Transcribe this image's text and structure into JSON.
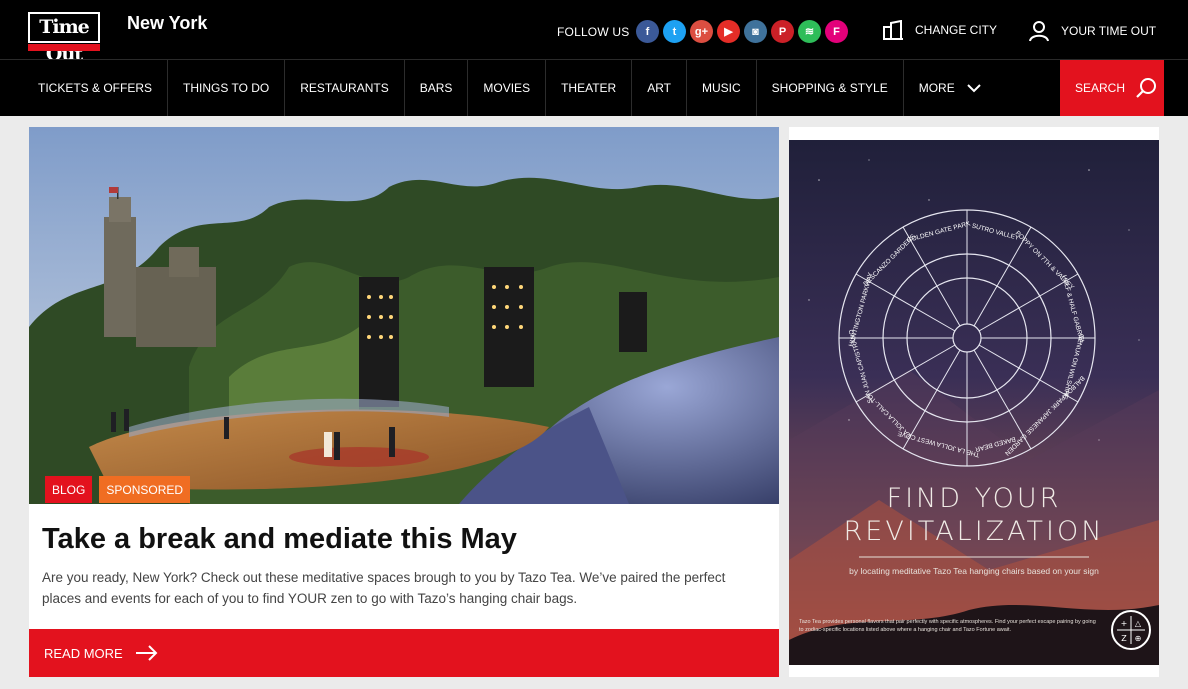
{
  "brand": {
    "logo_text": "Time Out",
    "city": "New York",
    "accent": "#e3121e"
  },
  "header": {
    "follow_label": "FOLLOW US",
    "socials": [
      {
        "icon": "facebook-icon",
        "glyph": "f",
        "color": "#3b5998"
      },
      {
        "icon": "twitter-icon",
        "glyph": "t",
        "color": "#1da1f2"
      },
      {
        "icon": "google-plus-icon",
        "glyph": "g+",
        "color": "#dc4e41"
      },
      {
        "icon": "youtube-icon",
        "glyph": "▶",
        "color": "#e52d27"
      },
      {
        "icon": "instagram-icon",
        "glyph": "◙",
        "color": "#3f729b"
      },
      {
        "icon": "pinterest-icon",
        "glyph": "P",
        "color": "#cb2027"
      },
      {
        "icon": "spotify-icon",
        "glyph": "≋",
        "color": "#2ebd59"
      },
      {
        "icon": "foursquare-icon",
        "glyph": "F",
        "color": "#e3007a"
      }
    ],
    "change_city": "CHANGE CITY",
    "your_timeout": "YOUR TIME OUT"
  },
  "nav": {
    "items": [
      {
        "label": "TICKETS & OFFERS"
      },
      {
        "label": "THINGS TO DO"
      },
      {
        "label": "RESTAURANTS"
      },
      {
        "label": "BARS"
      },
      {
        "label": "MOVIES"
      },
      {
        "label": "THEATER"
      },
      {
        "label": "ART"
      },
      {
        "label": "MUSIC"
      },
      {
        "label": "SHOPPING & STYLE"
      },
      {
        "label": "MORE"
      }
    ],
    "search_label": "SEARCH"
  },
  "feature": {
    "badges": [
      "BLOG",
      "SPONSORED"
    ],
    "headline": "Take a break and mediate this May",
    "summary": "Are you ready, New York? Check out these meditative spaces brough to you by Tazo Tea. We’ve paired the perfect places and events for each of you to find YOUR zen to go with Tazo’s hanging chair bags.",
    "read_more": "READ MORE"
  },
  "ad": {
    "headline_line1": "FIND YOUR",
    "headline_line2": "REVITALIZATION",
    "subline": "by locating meditative Tazo Tea hanging chairs based on your sign",
    "fine_print": "Tazo Tea provides personal flavors that pair perfectly with specific atmospheres. Find your perfect escape pairing by going to zodiac-specific locations listed above where a hanging chair and Tazo Fortune await.",
    "emblem_glyphs": "+ △ Z ⊕",
    "wheel_locations": [
      "SUTRO VALLEY",
      "POPPY ON 7TH & VALLEY",
      "HALF & HALF GABRIEL",
      "GENUA ON WILSHIRE",
      "BALBOA PARK JAPANESE GARDEN",
      "BAKED BEAR",
      "THE LA JOLLA WEST COVE",
      "LA JOLLA CALL-TO",
      "SAN JUAN CAPISTRANO",
      "HUNTINGTON PARKWAY",
      "DESCANZO GARDENS",
      "GOLDEN GATE PARK"
    ]
  }
}
